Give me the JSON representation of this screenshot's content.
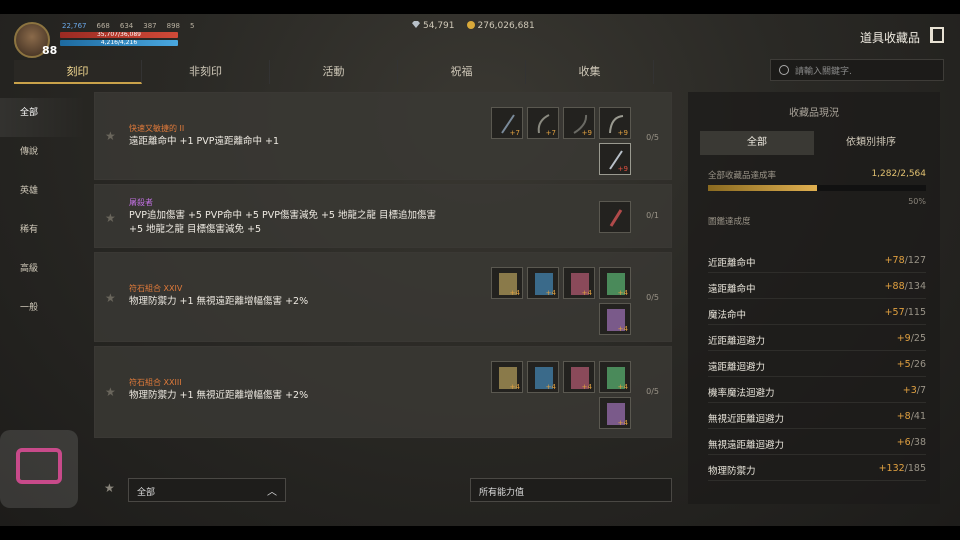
{
  "player": {
    "level": "88",
    "hp_text": "35,707/36,089",
    "mp_text": "4,216/4,216",
    "stats": [
      "22,767",
      "668",
      "634",
      "387",
      "898",
      "5"
    ]
  },
  "currency": {
    "gems": "54,791",
    "gold": "276,026,681"
  },
  "window_title": "道具收藏品",
  "tabs": [
    {
      "label": "刻印",
      "active": true
    },
    {
      "label": "非刻印",
      "active": false
    },
    {
      "label": "活動",
      "active": false
    },
    {
      "label": "祝福",
      "active": false
    },
    {
      "label": "收集",
      "active": false
    }
  ],
  "search": {
    "placeholder": "請輸入關鍵字."
  },
  "sidebar": {
    "items": [
      {
        "label": "全部",
        "active": true
      },
      {
        "label": "傳說",
        "active": false
      },
      {
        "label": "英雄",
        "active": false
      },
      {
        "label": "稀有",
        "active": false
      },
      {
        "label": "高級",
        "active": false
      },
      {
        "label": "一般",
        "active": false
      }
    ]
  },
  "entries": [
    {
      "name": "快速又敏捷的 II",
      "name_color": "#e07a3a",
      "desc": "遠距離命中 +1 PVP遠距離命中 +1",
      "progress": "0/5",
      "slot_values": [
        "+7",
        "+7",
        "+9",
        "+9",
        "+9"
      ]
    },
    {
      "name": "屠殺者",
      "name_color": "#c070e0",
      "desc": "PVP追加傷害 +5 PVP命中 +5 PVP傷害減免 +5 地龍之龍 目標追加傷害 +5 地龍之龍 目標傷害減免 +5",
      "progress": "0/1",
      "slot_values": [
        ""
      ]
    },
    {
      "name": "符石組合 XXIV",
      "name_color": "#e07a3a",
      "desc": "物理防禦力 +1 無視遠距離增幅傷害 +2%",
      "progress": "0/5",
      "slot_values": [
        "+4",
        "+4",
        "+4",
        "+4",
        "+4"
      ]
    },
    {
      "name": "符石組合 XXIII",
      "name_color": "#e07a3a",
      "desc": "物理防禦力 +1 無視近距離增幅傷害 +2%",
      "progress": "0/5",
      "slot_values": [
        "+4",
        "+4",
        "+4",
        "+4",
        "+4"
      ]
    }
  ],
  "filters": {
    "grade_value": "全部",
    "stat_value": "所有能力值"
  },
  "panel": {
    "title": "收藏品現況",
    "tabs": [
      {
        "label": "全部",
        "active": true
      },
      {
        "label": "依類別排序",
        "active": false
      }
    ],
    "completion_label": "全部收藏品達成率",
    "completion_ratio": "1,282/2,564",
    "completion_fraction": 0.5,
    "completion_percent": "50%",
    "stages_label": "圖鑑達成度",
    "stats": [
      {
        "name": "近距離命中",
        "value": "+78",
        "total": "/127"
      },
      {
        "name": "遠距離命中",
        "value": "+88",
        "total": "/134"
      },
      {
        "name": "魔法命中",
        "value": "+57",
        "total": "/115"
      },
      {
        "name": "近距離迴避力",
        "value": "+9",
        "total": "/25"
      },
      {
        "name": "遠距離迴避力",
        "value": "+5",
        "total": "/26"
      },
      {
        "name": "機率魔法迴避力",
        "value": "+3",
        "total": "/7"
      },
      {
        "name": "無視近距離迴避力",
        "value": "+8",
        "total": "/41"
      },
      {
        "name": "無視遠距離迴避力",
        "value": "+6",
        "total": "/38"
      },
      {
        "name": "物理防禦力",
        "value": "+132",
        "total": "/185"
      }
    ]
  },
  "colors": {
    "accent": "#c9a24a",
    "bonus": "#e0a040",
    "cast": "#c84a8a"
  }
}
